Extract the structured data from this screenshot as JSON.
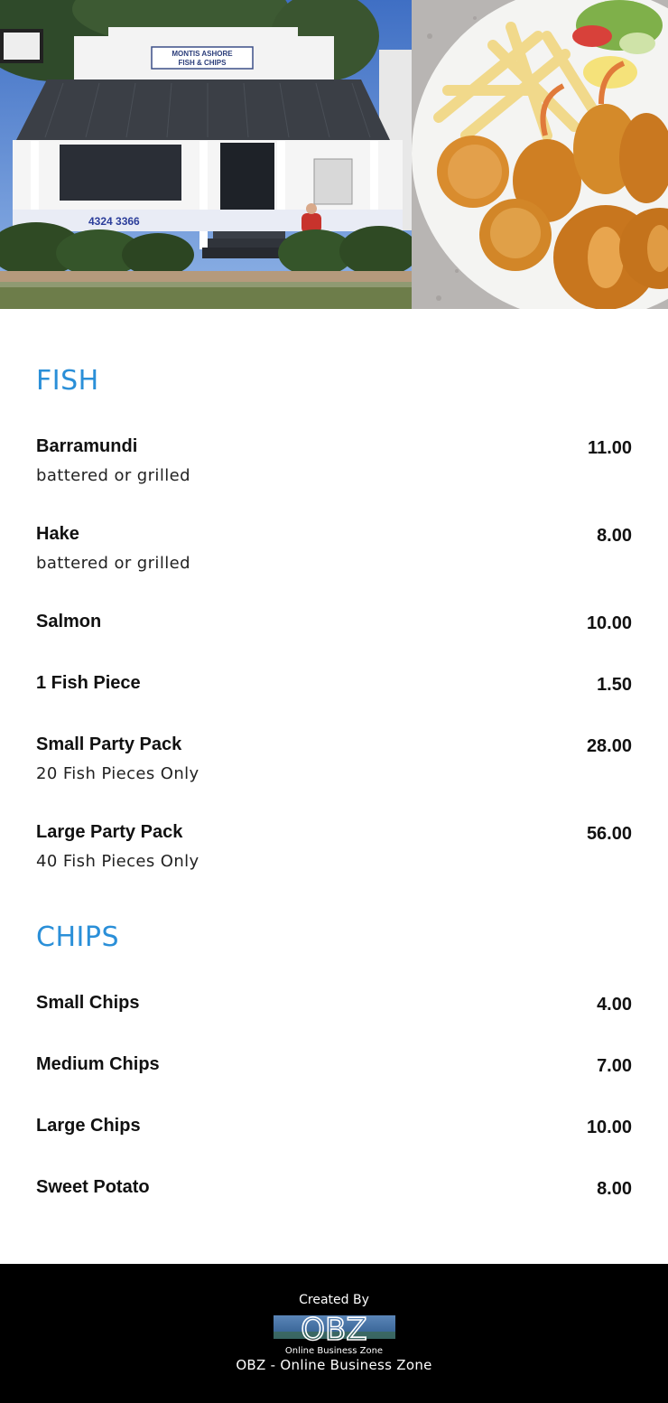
{
  "hero": {
    "shop_sign_line1": "MONTIS ASHORE",
    "shop_sign_line2": "FISH & CHIPS",
    "shop_phone": "4324 3366"
  },
  "sections": {
    "fish": {
      "title": "FISH",
      "items": [
        {
          "name": "Barramundi",
          "desc": "battered or grilled",
          "price": "11.00"
        },
        {
          "name": "Hake",
          "desc": "battered or grilled",
          "price": "8.00"
        },
        {
          "name": "Salmon",
          "price": "10.00"
        },
        {
          "name": "1 Fish Piece",
          "price": "1.50"
        },
        {
          "name": "Small Party Pack",
          "desc": "20 Fish Pieces Only",
          "price": "28.00"
        },
        {
          "name": "Large Party Pack",
          "desc": "40 Fish Pieces Only",
          "price": "56.00"
        }
      ]
    },
    "chips": {
      "title": "CHIPS",
      "items": [
        {
          "name": "Small Chips",
          "price": "4.00"
        },
        {
          "name": "Medium Chips",
          "price": "7.00"
        },
        {
          "name": "Large Chips",
          "price": "10.00"
        },
        {
          "name": "Sweet Potato",
          "price": "8.00"
        }
      ]
    }
  },
  "footer": {
    "created_by": "Created By",
    "logo_text": "OBZ",
    "logo_subtext": "Online Business Zone",
    "credit": "OBZ - Online Business Zone"
  },
  "colors": {
    "section_heading": "#2a8fd8",
    "footer_bg": "#000000"
  }
}
